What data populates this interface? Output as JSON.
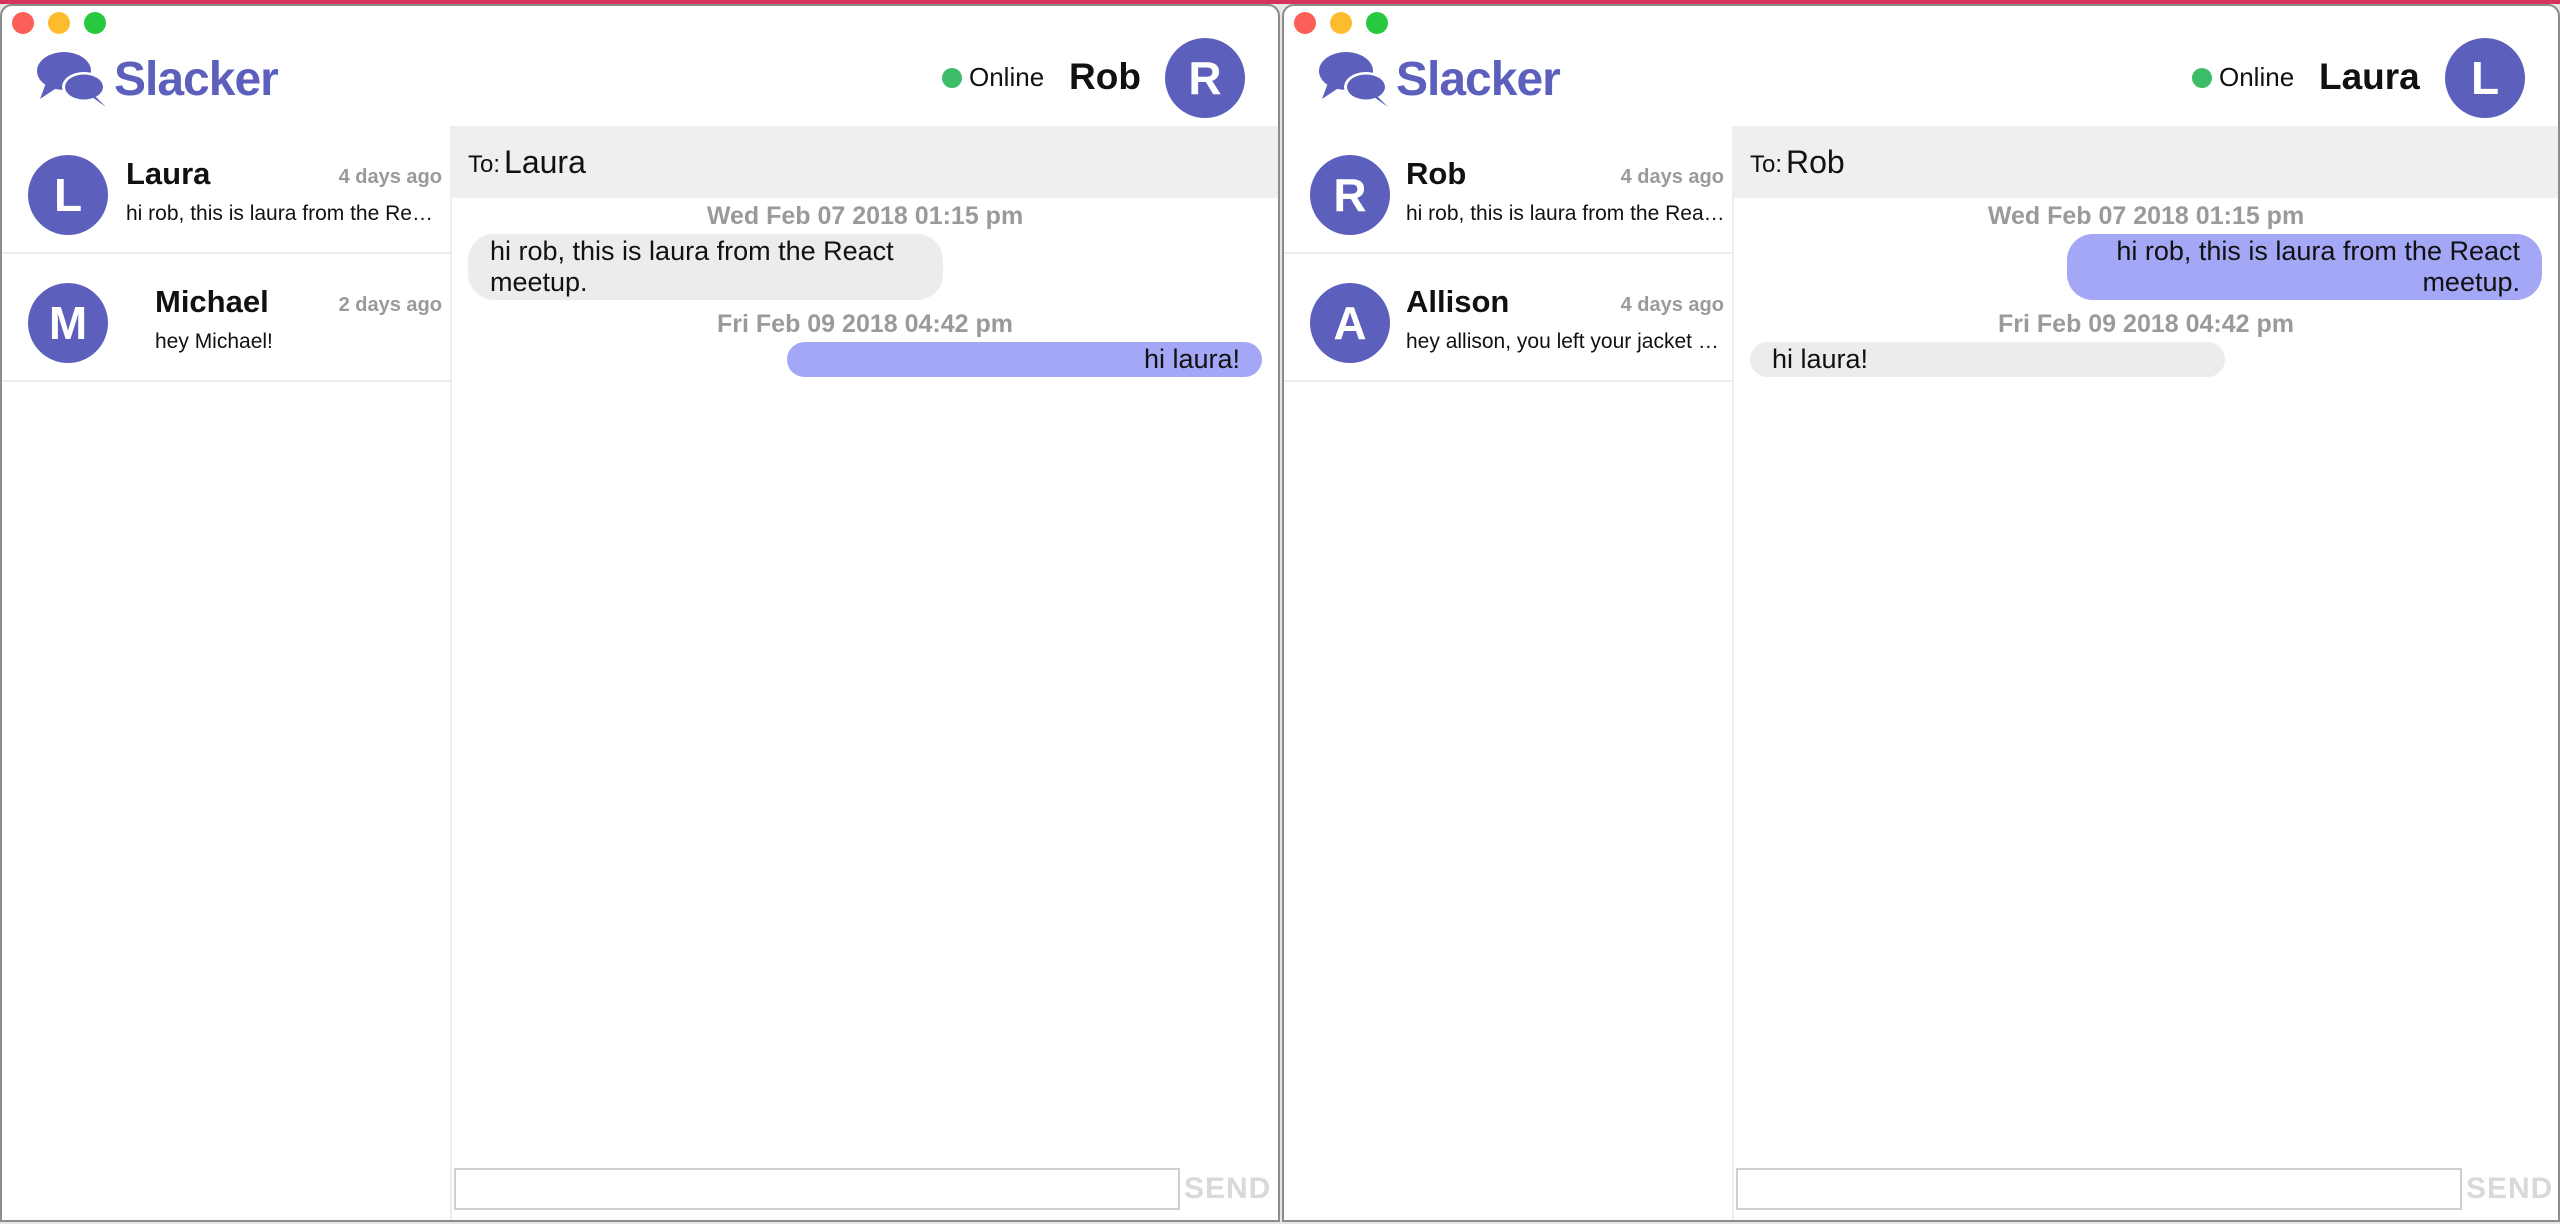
{
  "colors": {
    "brand": "#5d5fbd",
    "online": "#3dbd67",
    "sent_bubble": "#a4a7f5",
    "received_bubble": "#ececec"
  },
  "windows": [
    {
      "app_name": "Slacker",
      "status": "Online",
      "user": {
        "name": "Rob",
        "initial": "R"
      },
      "conversations": [
        {
          "initial": "L",
          "name": "Laura",
          "time": "4 days ago",
          "preview": "hi rob, this is laura from the React meetup."
        },
        {
          "initial": "M",
          "name": "Michael",
          "time": "2 days ago",
          "preview": "hey Michael!"
        }
      ],
      "chat": {
        "to_label": "To:",
        "to_name": "Laura",
        "messages": [
          {
            "date": "Wed Feb 07 2018 01:15 pm",
            "text": "hi rob, this is laura from the React meetup.",
            "direction": "received"
          },
          {
            "date": "Fri Feb 09 2018 04:42 pm",
            "text": "hi laura!",
            "direction": "sent"
          }
        ]
      },
      "composer": {
        "value": "",
        "send_label": "SEND"
      }
    },
    {
      "app_name": "Slacker",
      "status": "Online",
      "user": {
        "name": "Laura",
        "initial": "L"
      },
      "conversations": [
        {
          "initial": "R",
          "name": "Rob",
          "time": "4 days ago",
          "preview": "hi rob, this is laura from the React meetup."
        },
        {
          "initial": "A",
          "name": "Allison",
          "time": "4 days ago",
          "preview": "hey allison, you left your jacket at the meetup"
        }
      ],
      "chat": {
        "to_label": "To:",
        "to_name": "Rob",
        "messages": [
          {
            "date": "Wed Feb 07 2018 01:15 pm",
            "text": "hi rob, this is laura from the React meetup.",
            "direction": "sent"
          },
          {
            "date": "Fri Feb 09 2018 04:42 pm",
            "text": "hi laura!",
            "direction": "received"
          }
        ]
      },
      "composer": {
        "value": "",
        "send_label": "SEND"
      }
    }
  ]
}
